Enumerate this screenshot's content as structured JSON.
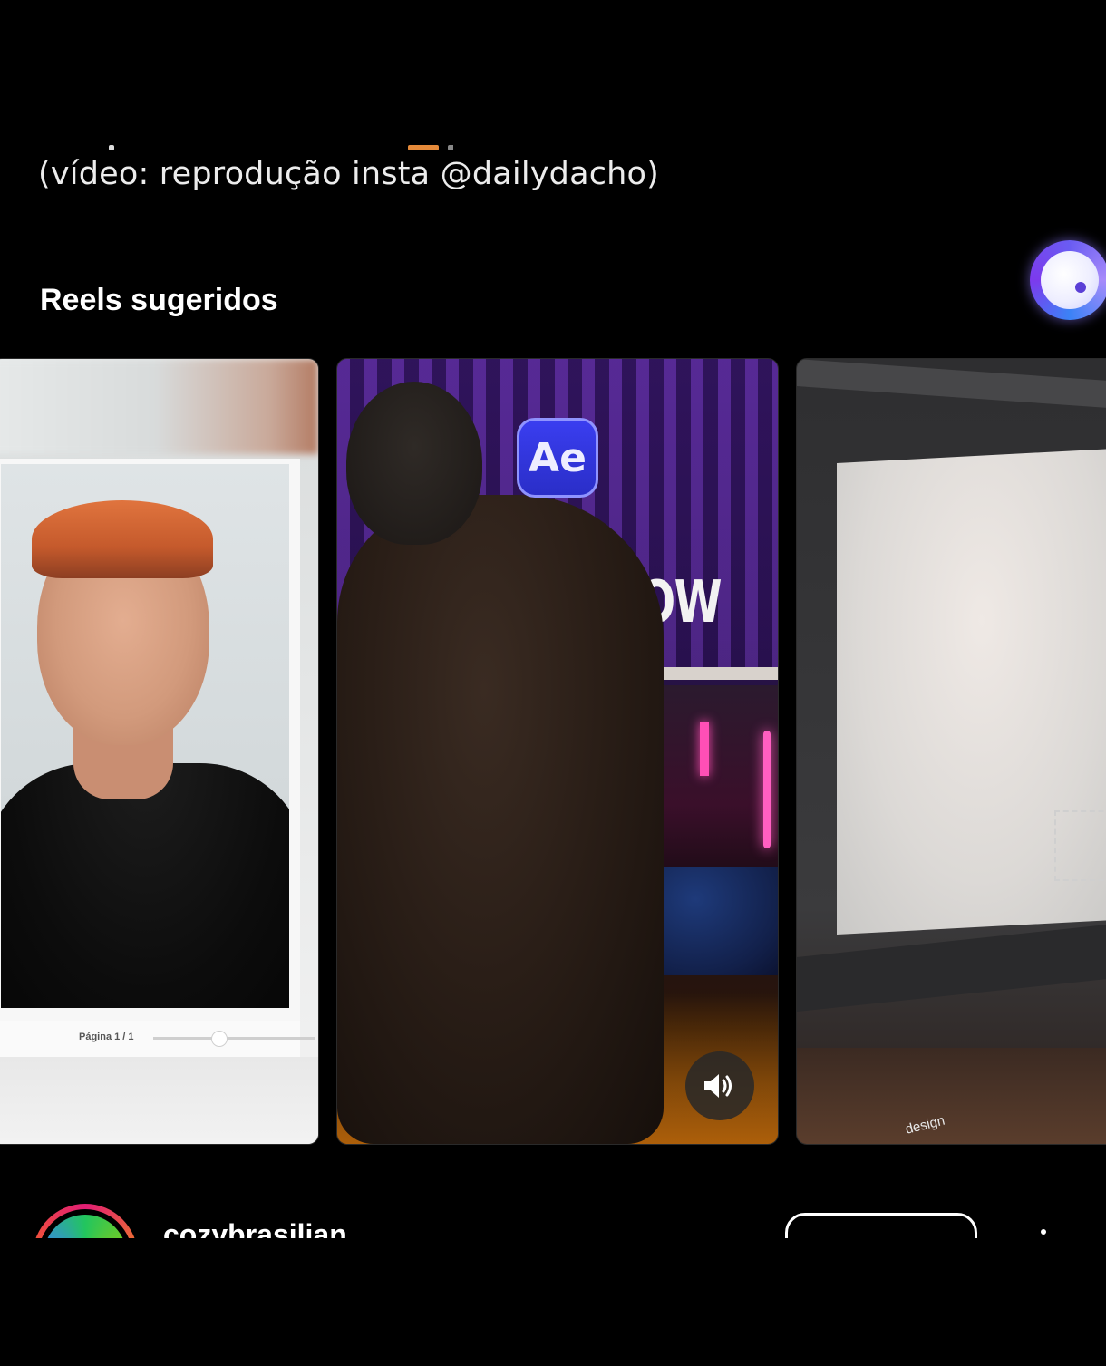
{
  "post": {
    "caption_tail": "(vídeo: reprodução insta @dailydacho)"
  },
  "suggested": {
    "title": "Reels sugeridos",
    "reels": [
      {
        "page_label": "Página 1 / 1"
      },
      {
        "badge": "Ae",
        "overlay_text": "KNOW",
        "sound_icon": "speaker-icon"
      },
      {
        "overlay_text": "design"
      }
    ]
  },
  "next_post": {
    "username": "cozybrasilian",
    "follow_label": ""
  },
  "icons": {
    "floating_bubble": "assistant-bubble-icon",
    "sound": "speaker-icon",
    "more": "more-options-icon"
  },
  "colors": {
    "background": "#000000",
    "text": "#ffffff"
  }
}
